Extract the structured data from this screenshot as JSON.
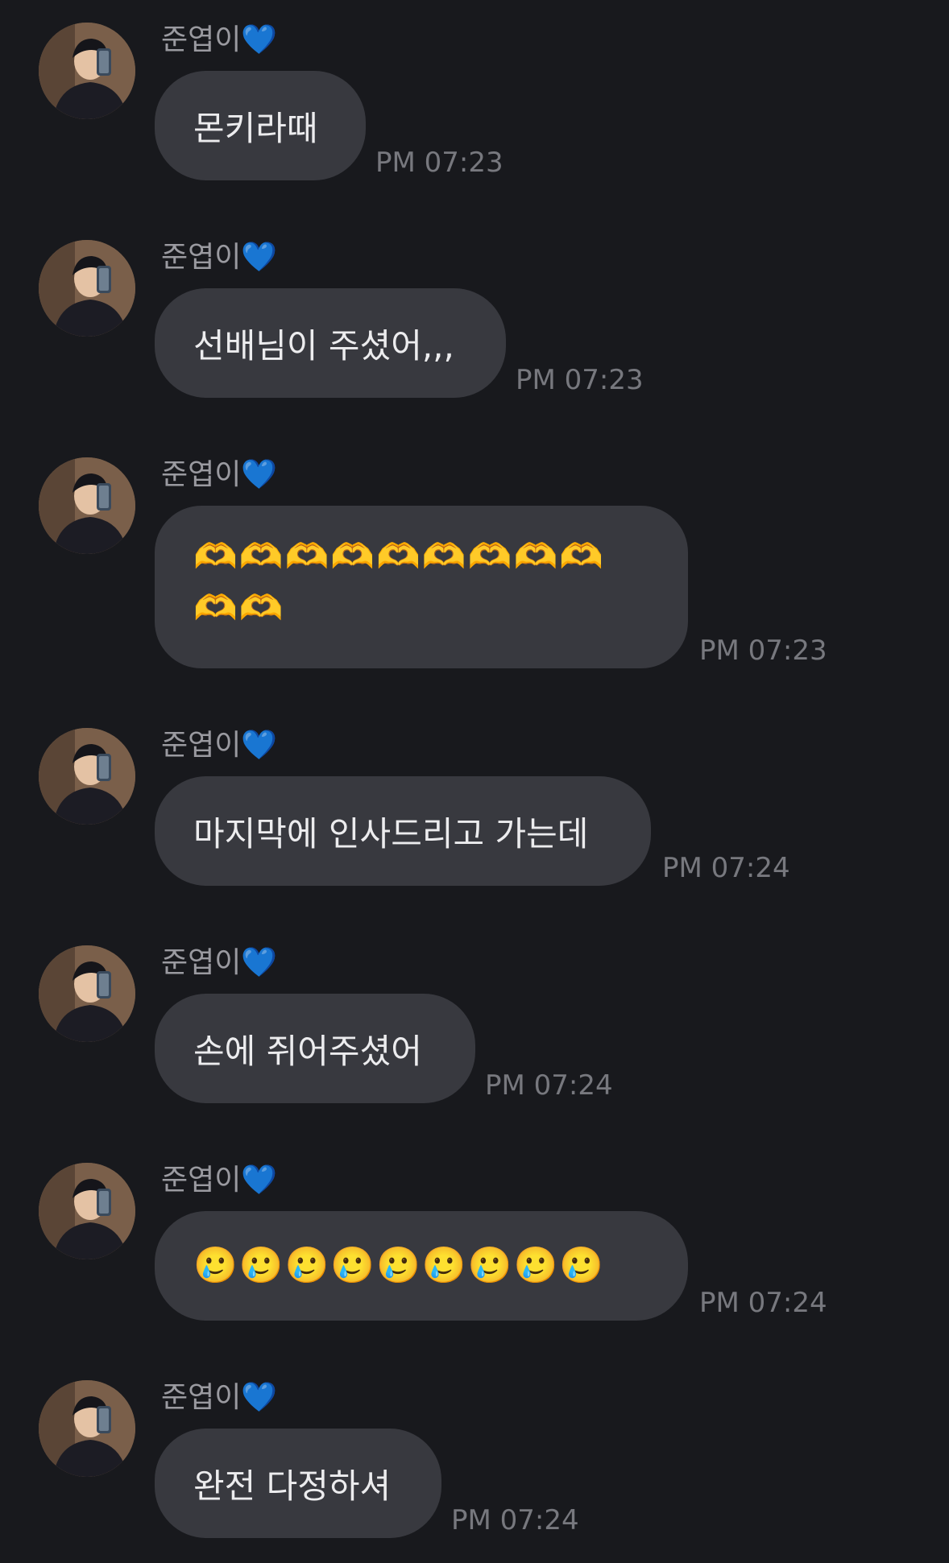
{
  "chat": {
    "sender_name": "준엽이💙",
    "messages": [
      {
        "text": "몬키라때",
        "time": "PM 07:23"
      },
      {
        "text": "선배님이 주셨어,,,",
        "time": "PM 07:23"
      },
      {
        "line1": "🫶🫶🫶🫶🫶🫶🫶🫶🫶",
        "line2": "🫶🫶",
        "time": "PM 07:23"
      },
      {
        "text": "마지막에 인사드리고 가는데",
        "time": "PM 07:24"
      },
      {
        "text": "손에 쥐어주셨어",
        "time": "PM 07:24"
      },
      {
        "text": "🥲🥲🥲🥲🥲🥲🥲🥲🥲",
        "time": "PM 07:24"
      },
      {
        "text": "완전 다정하셔",
        "time": "PM 07:24"
      }
    ]
  },
  "colors": {
    "background": "#18191d",
    "bubble": "#38393f",
    "sender_text": "#9a9aa0",
    "time_text": "#77787e",
    "message_text": "#ececee"
  }
}
